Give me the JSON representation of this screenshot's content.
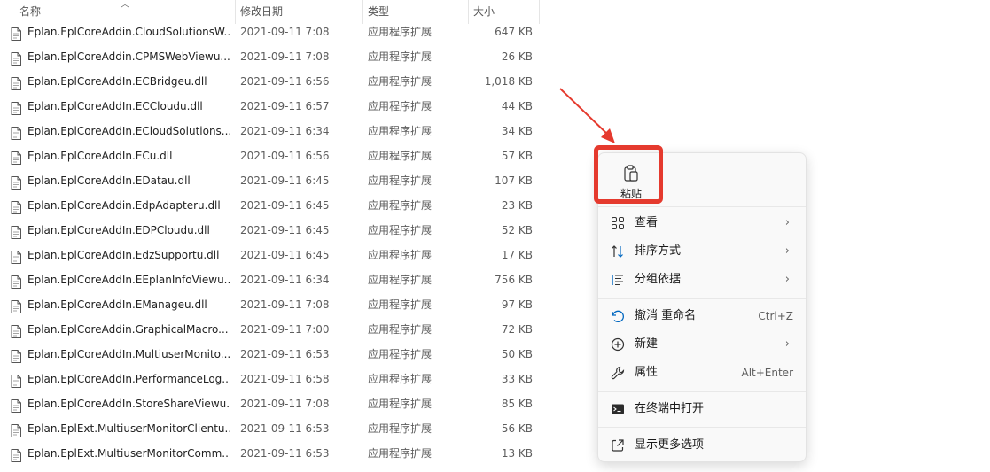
{
  "header": {
    "name": "名称",
    "date": "修改日期",
    "type": "类型",
    "size": "大小"
  },
  "files": [
    {
      "name": "Eplan.EplCoreAddin.CloudSolutionsW...",
      "date": "2021-09-11 7:08",
      "type": "应用程序扩展",
      "size": "647 KB"
    },
    {
      "name": "Eplan.EplCoreAddin.CPMSWebViewu...",
      "date": "2021-09-11 7:08",
      "type": "应用程序扩展",
      "size": "26 KB"
    },
    {
      "name": "Eplan.EplCoreAddIn.ECBridgeu.dll",
      "date": "2021-09-11 6:56",
      "type": "应用程序扩展",
      "size": "1,018 KB"
    },
    {
      "name": "Eplan.EplCoreAddIn.ECCloudu.dll",
      "date": "2021-09-11 6:57",
      "type": "应用程序扩展",
      "size": "44 KB"
    },
    {
      "name": "Eplan.EplCoreAddIn.ECloudSolutions...",
      "date": "2021-09-11 6:34",
      "type": "应用程序扩展",
      "size": "34 KB"
    },
    {
      "name": "Eplan.EplCoreAddIn.ECu.dll",
      "date": "2021-09-11 6:56",
      "type": "应用程序扩展",
      "size": "57 KB"
    },
    {
      "name": "Eplan.EplCoreAddIn.EDatau.dll",
      "date": "2021-09-11 6:45",
      "type": "应用程序扩展",
      "size": "107 KB"
    },
    {
      "name": "Eplan.EplCoreAddin.EdpAdapteru.dll",
      "date": "2021-09-11 6:45",
      "type": "应用程序扩展",
      "size": "23 KB"
    },
    {
      "name": "Eplan.EplCoreAddIn.EDPCloudu.dll",
      "date": "2021-09-11 6:45",
      "type": "应用程序扩展",
      "size": "52 KB"
    },
    {
      "name": "Eplan.EplCoreAddIn.EdzSupportu.dll",
      "date": "2021-09-11 6:45",
      "type": "应用程序扩展",
      "size": "17 KB"
    },
    {
      "name": "Eplan.EplCoreAddIn.EEplanInfoViewu...",
      "date": "2021-09-11 6:34",
      "type": "应用程序扩展",
      "size": "756 KB"
    },
    {
      "name": "Eplan.EplCoreAddIn.EManageu.dll",
      "date": "2021-09-11 7:08",
      "type": "应用程序扩展",
      "size": "97 KB"
    },
    {
      "name": "Eplan.EplCoreAddin.GraphicalMacro...",
      "date": "2021-09-11 7:00",
      "type": "应用程序扩展",
      "size": "72 KB"
    },
    {
      "name": "Eplan.EplCoreAddIn.MultiuserMonito...",
      "date": "2021-09-11 6:53",
      "type": "应用程序扩展",
      "size": "50 KB"
    },
    {
      "name": "Eplan.EplCoreAddIn.PerformanceLog...",
      "date": "2021-09-11 6:58",
      "type": "应用程序扩展",
      "size": "33 KB"
    },
    {
      "name": "Eplan.EplCoreAddIn.StoreShareViewu...",
      "date": "2021-09-11 7:08",
      "type": "应用程序扩展",
      "size": "85 KB"
    },
    {
      "name": "Eplan.EplExt.MultiuserMonitorClientu...",
      "date": "2021-09-11 6:53",
      "type": "应用程序扩展",
      "size": "56 KB"
    },
    {
      "name": "Eplan.EplExt.MultiuserMonitorComm...",
      "date": "2021-09-11 6:53",
      "type": "应用程序扩展",
      "size": "13 KB"
    }
  ],
  "menu": {
    "paste": "粘贴",
    "view": "查看",
    "sort": "排序方式",
    "group": "分组依据",
    "undo": "撤消 重命名",
    "undo_key": "Ctrl+Z",
    "new": "新建",
    "properties": "属性",
    "properties_key": "Alt+Enter",
    "terminal": "在终端中打开",
    "more": "显示更多选项"
  },
  "colors": {
    "highlight": "#e53a2e",
    "accent": "#0067c0"
  }
}
